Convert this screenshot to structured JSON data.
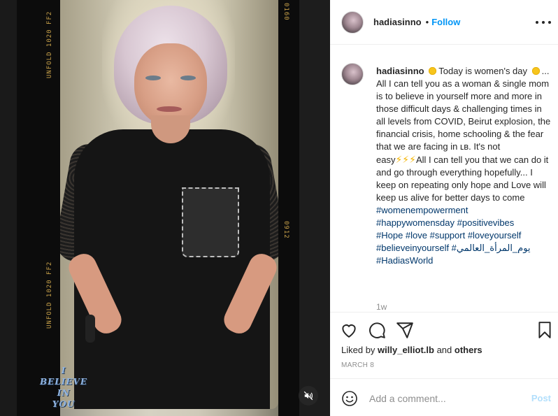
{
  "post": {
    "username": "hadiasinno",
    "follow_label": "Follow",
    "header_separator": "•",
    "caption": {
      "username": "hadiasinno",
      "segment_1": "Today is women's day",
      "segment_2": "... All I can tell you as a woman & single mom is to believe in yourself more and more in those difficult days & challenging times in all levels from COVID, Beirut explosion, the financial crisis, home schooling & the fear that we are facing in ʟʙ. It's not easy",
      "bolts": "⚡⚡⚡",
      "segment_3": "All I can tell you that we can do it and go through everything hopefully... I keep on repeating only hope and Love will keep us alive for better days to come",
      "hashtags": [
        "#womenempowerment",
        "#happywomensday #positivevibes",
        "#Hope #love #support #loveyourself",
        "#believeinyourself #يوم_المرأة_العالمي",
        "#HadiasWorld"
      ]
    },
    "age": "1w",
    "liked_by_prefix": "Liked by ",
    "liked_by_user": "willy_elliot.lb",
    "liked_by_suffix": " and ",
    "liked_by_others": "others",
    "date": "MARCH 8"
  },
  "media": {
    "film_labels": [
      "UNFOLD 1020 FF2",
      "UNFOLD 1020 FF2",
      "0160",
      "0912"
    ],
    "overlay_words": [
      "I",
      "BELIEVE",
      "IN",
      "YOU"
    ]
  },
  "comment": {
    "placeholder": "Add a comment...",
    "post_label": "Post"
  },
  "icons": [
    "more-options-icon",
    "heart-icon",
    "comment-icon",
    "share-icon",
    "bookmark-icon",
    "smiley-icon",
    "mute-icon",
    "sun-emoji-icon"
  ],
  "colors": {
    "follow": "#0095f6",
    "hashtag": "#00376b",
    "muted_text": "#8e8e8e",
    "post_disabled": "#b2dffc"
  }
}
